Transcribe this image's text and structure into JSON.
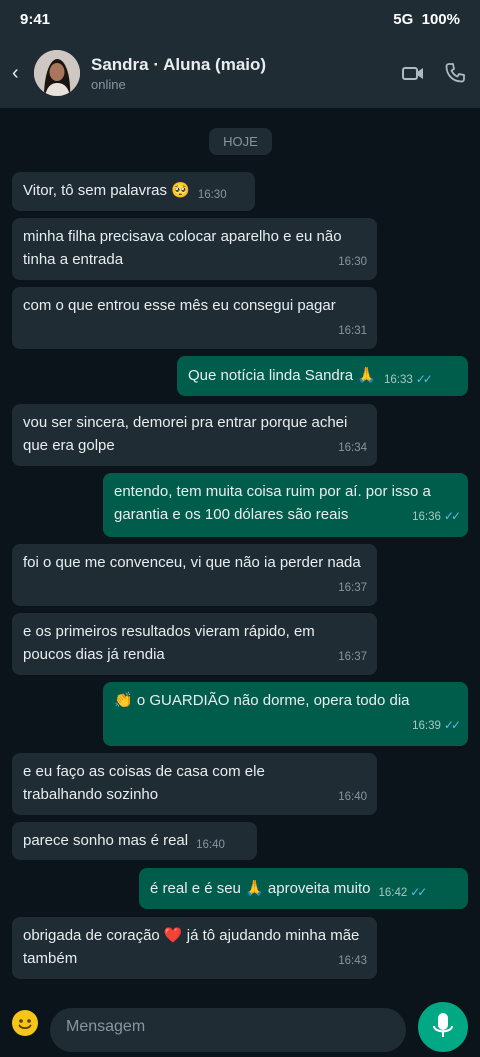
{
  "status": {
    "time": "9:41",
    "network": "5G",
    "battery": "100%"
  },
  "header": {
    "back_label": "‹",
    "contact_name": "Sandra · Aluna (maio)",
    "presence": "online",
    "icons": [
      "back-icon",
      "video-call-icon",
      "phone-icon"
    ]
  },
  "chat": {
    "date_chip": "HOJE",
    "messages": [
      {
        "dir": "in",
        "text": "Vitor, tô sem palavras 🥺",
        "time": "16:30"
      },
      {
        "dir": "in",
        "text": "minha filha precisava colocar aparelho e eu não tinha a entrada",
        "time": "16:30"
      },
      {
        "dir": "in",
        "text": "com o que entrou esse mês eu consegui pagar",
        "time": "16:31"
      },
      {
        "dir": "out",
        "text": "Que notícia linda Sandra 🙏",
        "time": "16:33",
        "ticks": "✓✓"
      },
      {
        "dir": "in",
        "text": "vou ser sincera, demorei pra entrar porque achei que era golpe",
        "time": "16:34"
      },
      {
        "dir": "out",
        "text": "entendo, tem muita coisa ruim por aí. por isso a garantia e os 100 dólares são reais",
        "time": "16:36",
        "ticks": "✓✓"
      },
      {
        "dir": "in",
        "text": "foi o que me convenceu, vi que não ia perder nada",
        "time": "16:37"
      },
      {
        "dir": "in",
        "text": "e os primeiros resultados vieram rápido, em poucos dias já rendia",
        "time": "16:37"
      },
      {
        "dir": "out",
        "text": "👏 o GUARDIÃO não dorme, opera todo dia",
        "time": "16:39",
        "ticks": "✓✓"
      },
      {
        "dir": "in",
        "text": "e eu faço as coisas de casa com ele trabalhando sozinho",
        "time": "16:40"
      },
      {
        "dir": "in",
        "text": "parece sonho mas é real",
        "time": "16:40"
      },
      {
        "dir": "out",
        "text": "é real e é seu 🙏 aproveita muito",
        "time": "16:42",
        "ticks": "✓✓"
      },
      {
        "dir": "in",
        "text": "obrigada de coração ❤️ já tô ajudando minha mãe também",
        "time": "16:43"
      }
    ]
  },
  "composer": {
    "placeholder": "Mensagem",
    "icons": [
      "emoji-icon",
      "mic-icon"
    ]
  },
  "colors": {
    "background": "#0b141a",
    "header": "#1f2c34",
    "incoming_bubble": "#1f2c34",
    "outgoing_bubble": "#005c4b",
    "read_ticks": "#53bdeb",
    "accent": "#00a884"
  }
}
